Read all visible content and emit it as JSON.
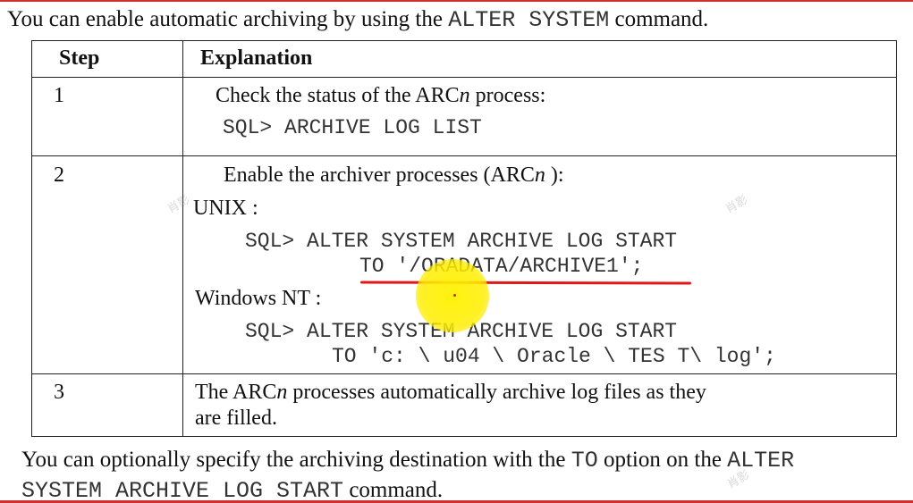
{
  "intro": {
    "text_before": "You can enable automatic archiving by using the ",
    "command": "ALTER SYSTEM",
    "text_after": " command."
  },
  "table": {
    "headers": {
      "step": "Step",
      "explanation": "Explanation"
    },
    "rows": [
      {
        "step": "1",
        "text_before": "Check the status of the ARC",
        "text_italic": "n",
        "text_after": " process:",
        "code": "SQL> ARCHIVE LOG LIST"
      },
      {
        "step": "2",
        "text_before": "Enable the archiver processes (ARC",
        "text_italic": "n",
        "text_after": " ):",
        "unix_label": "UNIX :",
        "unix_code_1": "SQL> ALTER SYSTEM ARCHIVE LOG START",
        "unix_code_2": "TO '/ORADATA/ARCHIVE1';",
        "windows_label": "Windows NT :",
        "windows_code_1": "SQL> ALTER SYSTEM ARCHIVE LOG START",
        "windows_code_2": "TO 'c: \\ u04 \\ Oracle \\ TES T\\ log';"
      },
      {
        "step": "3",
        "text_before": "The ARC",
        "text_italic": "n",
        "text_after": " processes automatically archive log files as they",
        "text_line2": "are filled."
      }
    ]
  },
  "outro": {
    "text_1": "You can optionally specify the archiving destination with the ",
    "code_1": "TO",
    "text_2": " option on the ",
    "code_2": "ALTER",
    "code_3": "SYSTEM ARCHIVE LOG START",
    "text_3": " command."
  },
  "watermark_text": "肖影"
}
